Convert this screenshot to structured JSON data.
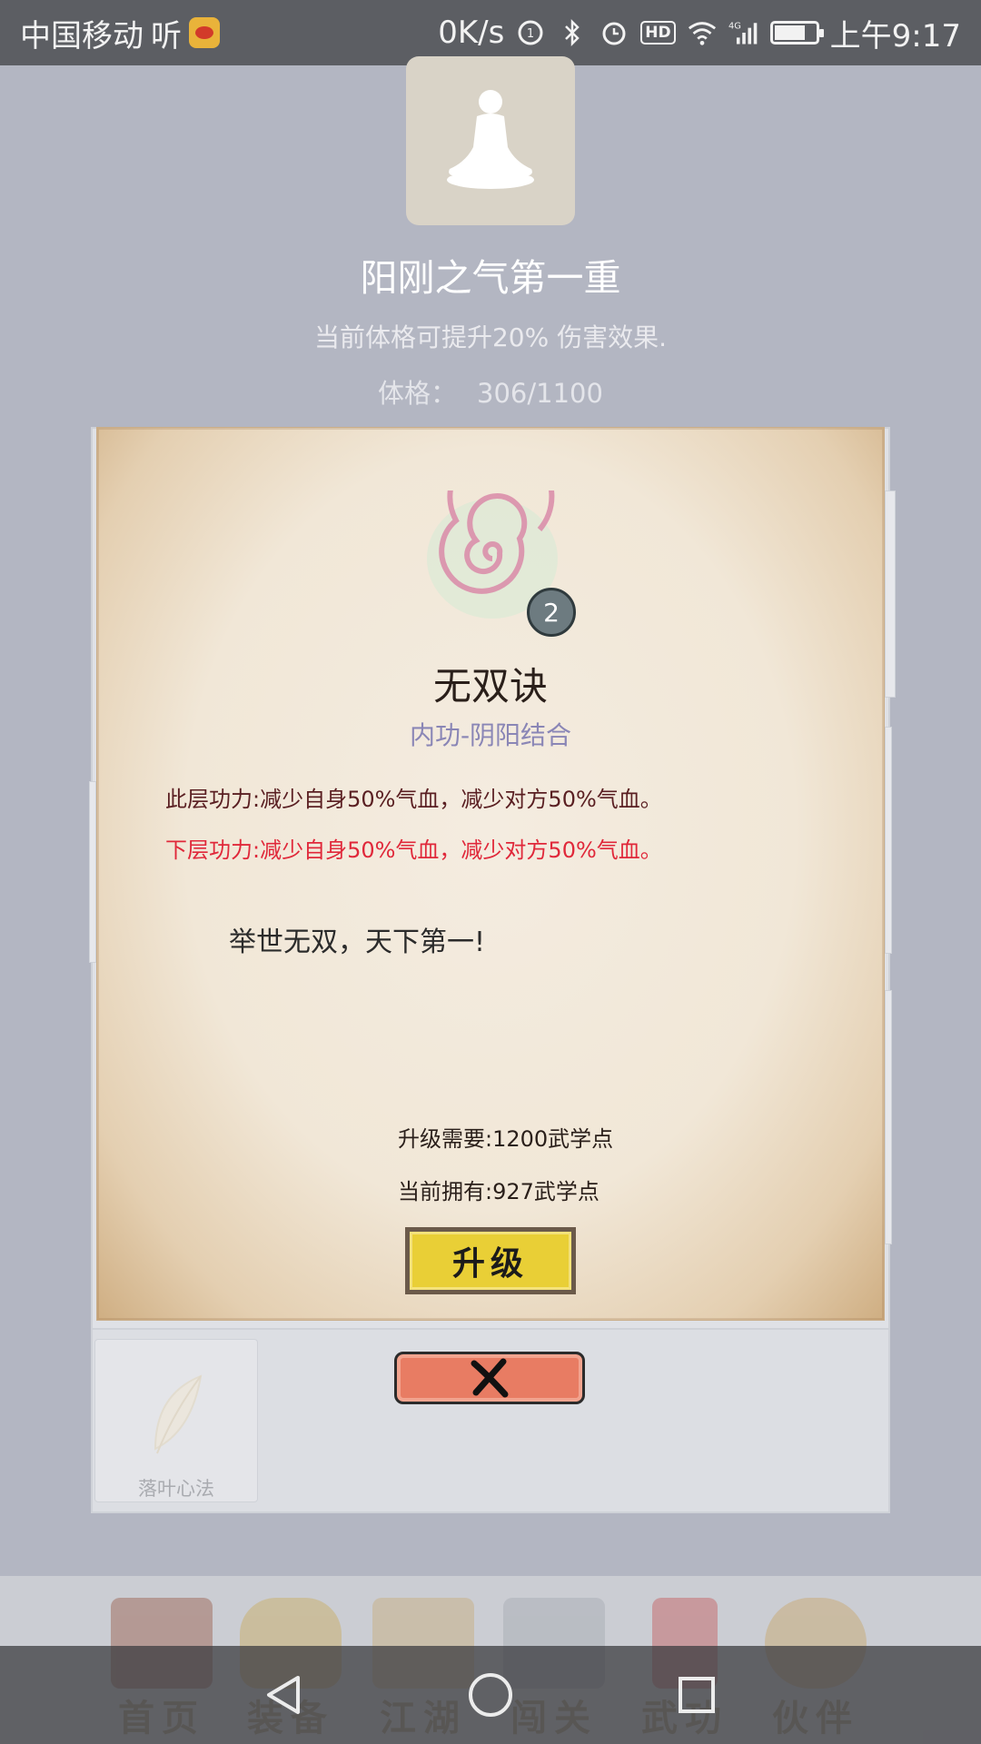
{
  "status_bar": {
    "carrier": "中国移动",
    "app_mark": "听",
    "net_speed": "0K/s",
    "hd": "HD",
    "network": "4G",
    "time": "上午9:17"
  },
  "header": {
    "title": "阳刚之气第一重",
    "description": "当前体格可提升20% 伤害效果.",
    "stat_label": "体格：",
    "stat_value": "306/1100"
  },
  "skill": {
    "level": "2",
    "name": "无双诀",
    "type": "内功-阴阳结合",
    "current_effect": "此层功力:减少自身50%气血，减少对方50%气血。",
    "next_effect": "下层功力:减少自身50%气血，减少对方50%气血。",
    "motto": "举世无双，天下第一!",
    "requirement": "升级需要:1200武学点",
    "owned": "当前拥有:927武学点",
    "upgrade_label": "升级"
  },
  "list": {
    "item_label": "落叶心法"
  },
  "tabs": [
    {
      "label": "首页",
      "icon": "temple-icon"
    },
    {
      "label": "装备",
      "icon": "armor-icon"
    },
    {
      "label": "江湖",
      "icon": "scroll-icon"
    },
    {
      "label": "闯关",
      "icon": "swords-icon"
    },
    {
      "label": "武功",
      "icon": "book-icon"
    },
    {
      "label": "伙伴",
      "icon": "people-icon"
    }
  ],
  "colors": {
    "next_effect": "#e0283a",
    "current_effect": "#5a1f22",
    "skill_type": "#8a86b6",
    "upgrade_button": "#e9cf36",
    "close_button": "#e87c63"
  }
}
